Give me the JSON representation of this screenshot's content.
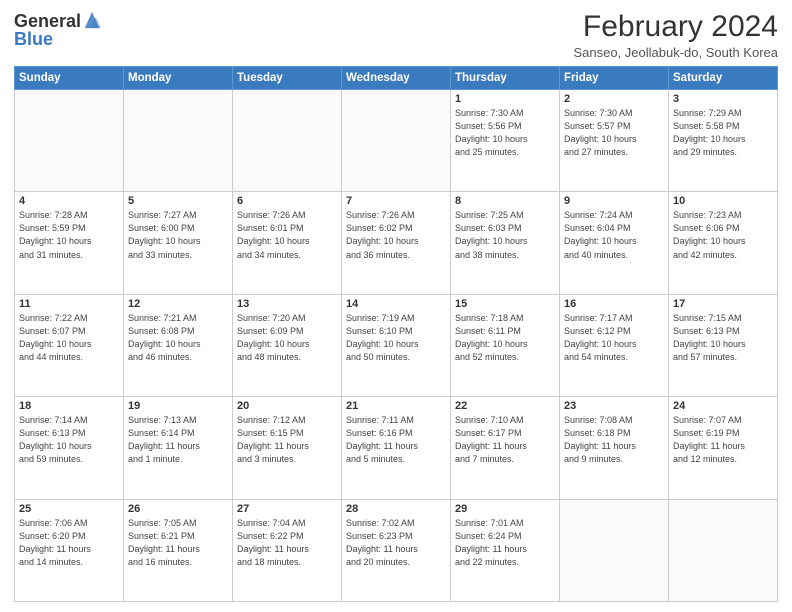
{
  "header": {
    "logo_general": "General",
    "logo_blue": "Blue",
    "title": "February 2024",
    "subtitle": "Sanseo, Jeollabuk-do, South Korea"
  },
  "days_of_week": [
    "Sunday",
    "Monday",
    "Tuesday",
    "Wednesday",
    "Thursday",
    "Friday",
    "Saturday"
  ],
  "weeks": [
    [
      {
        "day": "",
        "info": ""
      },
      {
        "day": "",
        "info": ""
      },
      {
        "day": "",
        "info": ""
      },
      {
        "day": "",
        "info": ""
      },
      {
        "day": "1",
        "info": "Sunrise: 7:30 AM\nSunset: 5:56 PM\nDaylight: 10 hours\nand 25 minutes."
      },
      {
        "day": "2",
        "info": "Sunrise: 7:30 AM\nSunset: 5:57 PM\nDaylight: 10 hours\nand 27 minutes."
      },
      {
        "day": "3",
        "info": "Sunrise: 7:29 AM\nSunset: 5:58 PM\nDaylight: 10 hours\nand 29 minutes."
      }
    ],
    [
      {
        "day": "4",
        "info": "Sunrise: 7:28 AM\nSunset: 5:59 PM\nDaylight: 10 hours\nand 31 minutes."
      },
      {
        "day": "5",
        "info": "Sunrise: 7:27 AM\nSunset: 6:00 PM\nDaylight: 10 hours\nand 33 minutes."
      },
      {
        "day": "6",
        "info": "Sunrise: 7:26 AM\nSunset: 6:01 PM\nDaylight: 10 hours\nand 34 minutes."
      },
      {
        "day": "7",
        "info": "Sunrise: 7:26 AM\nSunset: 6:02 PM\nDaylight: 10 hours\nand 36 minutes."
      },
      {
        "day": "8",
        "info": "Sunrise: 7:25 AM\nSunset: 6:03 PM\nDaylight: 10 hours\nand 38 minutes."
      },
      {
        "day": "9",
        "info": "Sunrise: 7:24 AM\nSunset: 6:04 PM\nDaylight: 10 hours\nand 40 minutes."
      },
      {
        "day": "10",
        "info": "Sunrise: 7:23 AM\nSunset: 6:06 PM\nDaylight: 10 hours\nand 42 minutes."
      }
    ],
    [
      {
        "day": "11",
        "info": "Sunrise: 7:22 AM\nSunset: 6:07 PM\nDaylight: 10 hours\nand 44 minutes."
      },
      {
        "day": "12",
        "info": "Sunrise: 7:21 AM\nSunset: 6:08 PM\nDaylight: 10 hours\nand 46 minutes."
      },
      {
        "day": "13",
        "info": "Sunrise: 7:20 AM\nSunset: 6:09 PM\nDaylight: 10 hours\nand 48 minutes."
      },
      {
        "day": "14",
        "info": "Sunrise: 7:19 AM\nSunset: 6:10 PM\nDaylight: 10 hours\nand 50 minutes."
      },
      {
        "day": "15",
        "info": "Sunrise: 7:18 AM\nSunset: 6:11 PM\nDaylight: 10 hours\nand 52 minutes."
      },
      {
        "day": "16",
        "info": "Sunrise: 7:17 AM\nSunset: 6:12 PM\nDaylight: 10 hours\nand 54 minutes."
      },
      {
        "day": "17",
        "info": "Sunrise: 7:15 AM\nSunset: 6:13 PM\nDaylight: 10 hours\nand 57 minutes."
      }
    ],
    [
      {
        "day": "18",
        "info": "Sunrise: 7:14 AM\nSunset: 6:13 PM\nDaylight: 10 hours\nand 59 minutes."
      },
      {
        "day": "19",
        "info": "Sunrise: 7:13 AM\nSunset: 6:14 PM\nDaylight: 11 hours\nand 1 minute."
      },
      {
        "day": "20",
        "info": "Sunrise: 7:12 AM\nSunset: 6:15 PM\nDaylight: 11 hours\nand 3 minutes."
      },
      {
        "day": "21",
        "info": "Sunrise: 7:11 AM\nSunset: 6:16 PM\nDaylight: 11 hours\nand 5 minutes."
      },
      {
        "day": "22",
        "info": "Sunrise: 7:10 AM\nSunset: 6:17 PM\nDaylight: 11 hours\nand 7 minutes."
      },
      {
        "day": "23",
        "info": "Sunrise: 7:08 AM\nSunset: 6:18 PM\nDaylight: 11 hours\nand 9 minutes."
      },
      {
        "day": "24",
        "info": "Sunrise: 7:07 AM\nSunset: 6:19 PM\nDaylight: 11 hours\nand 12 minutes."
      }
    ],
    [
      {
        "day": "25",
        "info": "Sunrise: 7:06 AM\nSunset: 6:20 PM\nDaylight: 11 hours\nand 14 minutes."
      },
      {
        "day": "26",
        "info": "Sunrise: 7:05 AM\nSunset: 6:21 PM\nDaylight: 11 hours\nand 16 minutes."
      },
      {
        "day": "27",
        "info": "Sunrise: 7:04 AM\nSunset: 6:22 PM\nDaylight: 11 hours\nand 18 minutes."
      },
      {
        "day": "28",
        "info": "Sunrise: 7:02 AM\nSunset: 6:23 PM\nDaylight: 11 hours\nand 20 minutes."
      },
      {
        "day": "29",
        "info": "Sunrise: 7:01 AM\nSunset: 6:24 PM\nDaylight: 11 hours\nand 22 minutes."
      },
      {
        "day": "",
        "info": ""
      },
      {
        "day": "",
        "info": ""
      }
    ]
  ]
}
